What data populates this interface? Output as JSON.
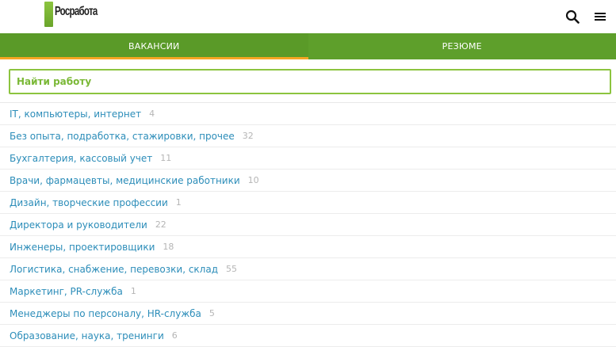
{
  "header": {
    "logo_text": "Росработа",
    "search_icon": "search-icon",
    "menu_icon": "menu-icon"
  },
  "tabs": [
    {
      "label": "ВАКАНСИИ",
      "active": true
    },
    {
      "label": "РЕЗЮМЕ",
      "active": false
    }
  ],
  "search": {
    "placeholder": "Найти работу"
  },
  "categories": [
    {
      "label": "IT, компьютеры, интернет",
      "count": "4"
    },
    {
      "label": "Без опыта, подработка, стажировки, прочее",
      "count": "32"
    },
    {
      "label": "Бухгалтерия, кассовый учет",
      "count": "11"
    },
    {
      "label": "Врачи, фармацевты, медицинские работники",
      "count": "10"
    },
    {
      "label": "Дизайн, творческие профессии",
      "count": "1"
    },
    {
      "label": "Директора и руководители",
      "count": "22"
    },
    {
      "label": "Инженеры, проектировщики",
      "count": "18"
    },
    {
      "label": "Логистика, снабжение, перевозки, склад",
      "count": "55"
    },
    {
      "label": "Маркетинг, PR-служба",
      "count": "1"
    },
    {
      "label": "Менеджеры по персоналу, HR-служба",
      "count": "5"
    },
    {
      "label": "Образование, наука, тренинги",
      "count": "6"
    }
  ],
  "colors": {
    "accent_green": "#5e9f2b",
    "tab_underline": "#f5a623",
    "link_blue": "#2c8db9",
    "count_gray": "#b5b5b5"
  }
}
